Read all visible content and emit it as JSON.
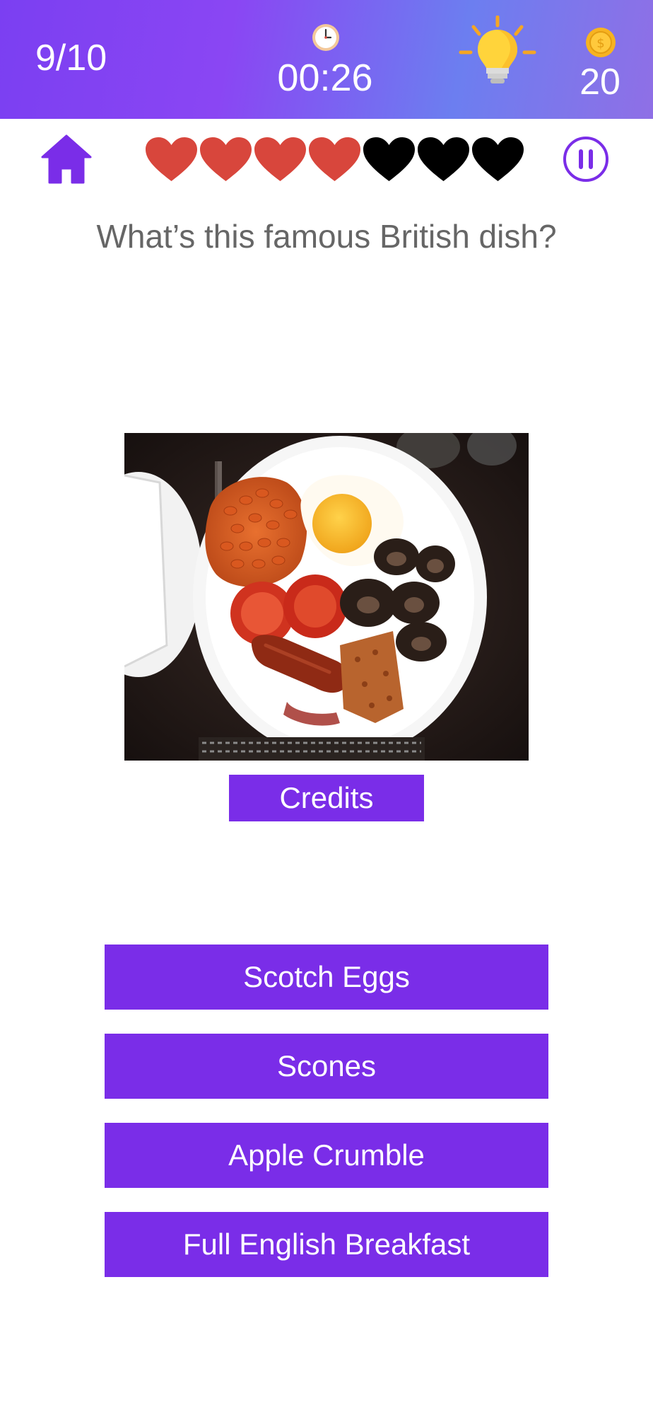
{
  "header": {
    "progress": "9/10",
    "timer": "00:26",
    "coins": "20"
  },
  "lives": {
    "remaining": 4,
    "total": 7
  },
  "question": {
    "text": "What’s this famous British dish?"
  },
  "credits": {
    "label": "Credits"
  },
  "answers": [
    {
      "label": "Scotch Eggs"
    },
    {
      "label": "Scones"
    },
    {
      "label": "Apple Crumble"
    },
    {
      "label": "Full English Breakfast"
    }
  ],
  "colors": {
    "accent": "#7a2de8",
    "heart_full": "#d8463c",
    "heart_empty": "#000000",
    "question_text": "#666666"
  },
  "icons": {
    "home": "home-icon",
    "pause": "pause-icon",
    "hint": "lightbulb-icon",
    "timer": "clock-icon",
    "coin": "coin-icon"
  }
}
